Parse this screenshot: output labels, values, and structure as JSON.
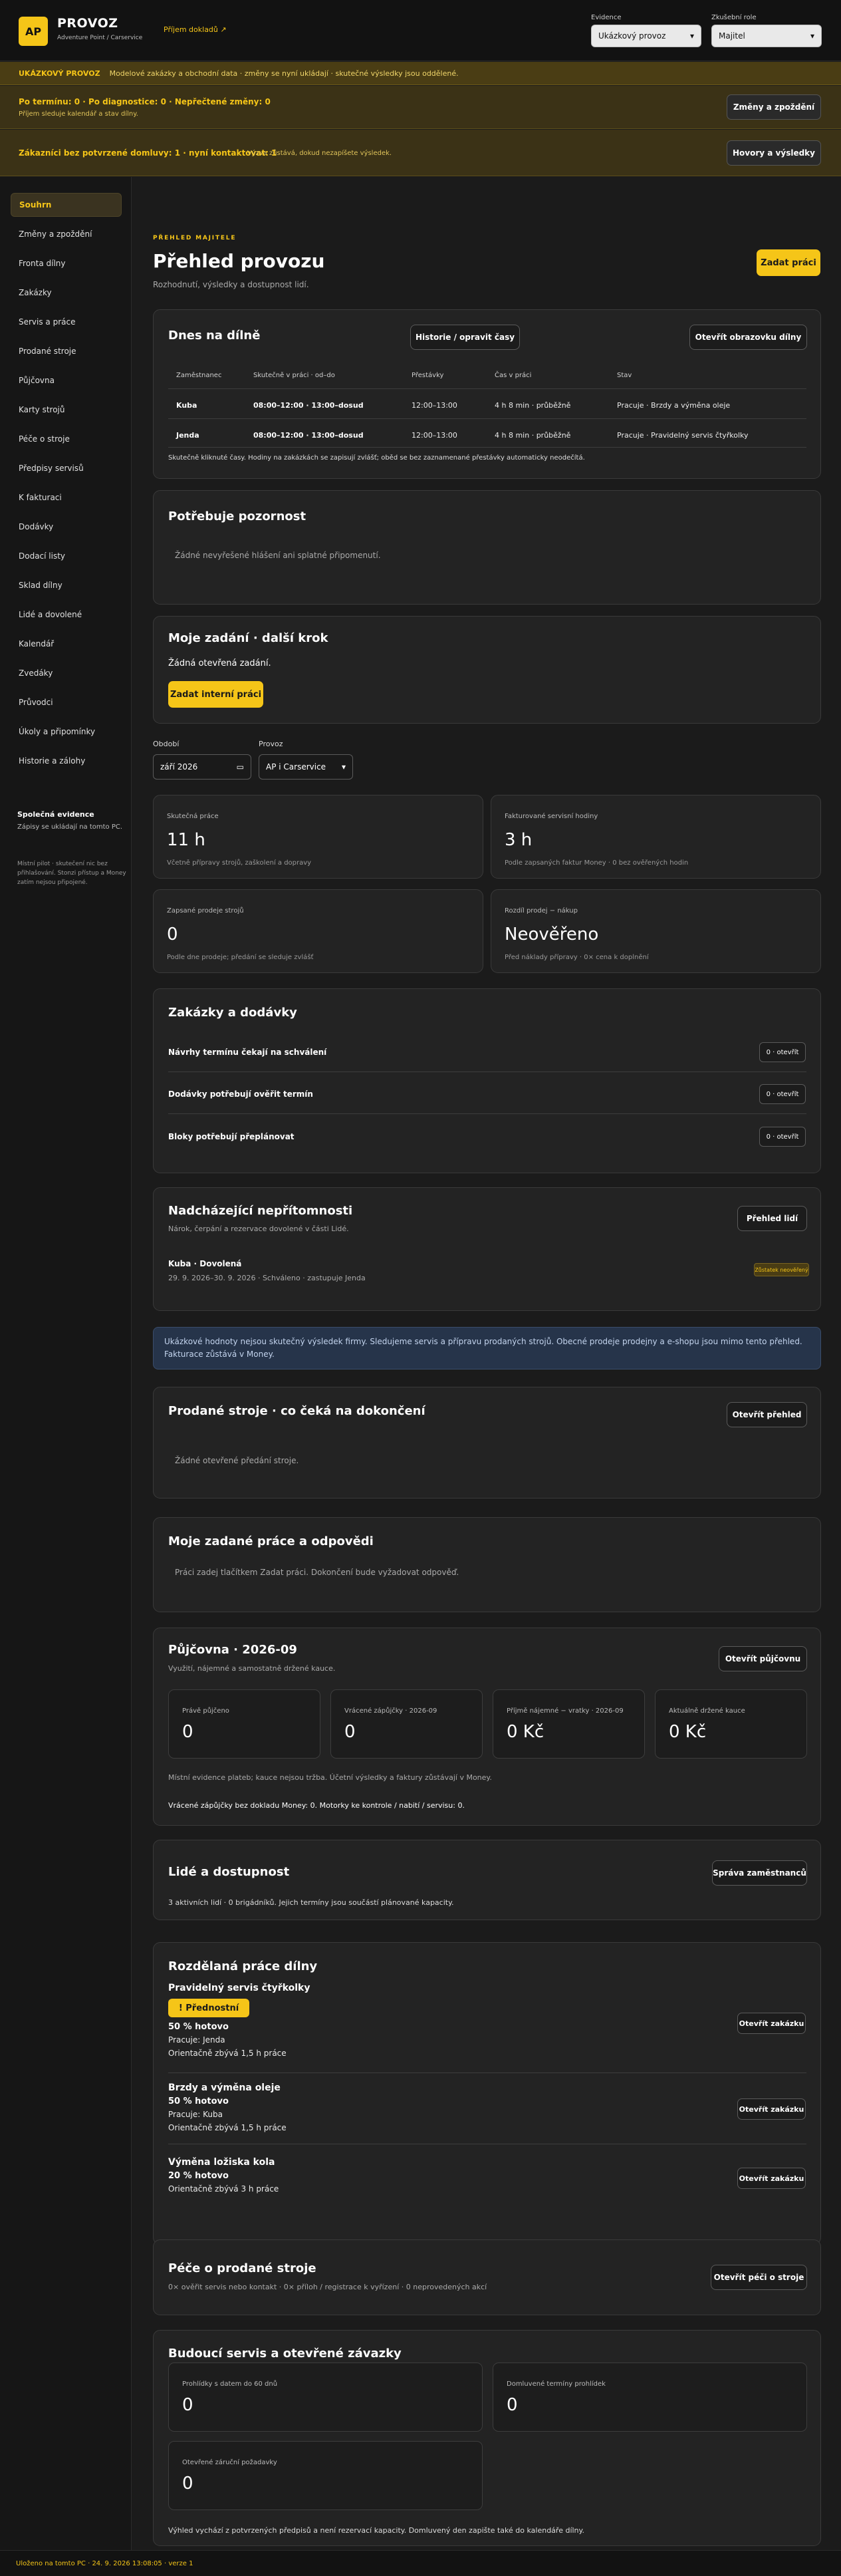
{
  "header": {
    "logo": "AP",
    "title": "PROVOZ",
    "subtitle": "Adventure Point / Carservice",
    "receive_link": "Příjem dokladů ↗",
    "evidence_label": "Evidence",
    "evidence_value": "Ukázkový provoz",
    "role_label": "Zkušební role",
    "role_value": "Majitel"
  },
  "banners": {
    "demo_badge": "UKÁZKOVÝ PROVOZ",
    "demo_text": "Modelové zakázky a obchodní data · změny se nyní ukládají · skutečné výsledky jsou oddělené.",
    "deadlines_title": "Po termínu: 0 · Po diagnostice: 0 · Nepřečtené změny: 0",
    "deadlines_sub": "Příjem sleduje kalendář a stav dílny.",
    "deadlines_button": "Změny a zpoždění",
    "unconfirmed_title": "Zákazníci bez potvrzené domluvy: 1 · nyní kontaktovat: 1",
    "unconfirmed_sub": "Výzva zůstává, dokud nezapíšete výsledek.",
    "unconfirmed_button": "Hovory a výsledky"
  },
  "sidebar": {
    "items": [
      "Souhrn",
      "Změny a zpoždění",
      "Fronta dílny",
      "Zakázky",
      "Servis a práce",
      "Prodané stroje",
      "Půjčovna",
      "Karty strojů",
      "Péče o stroje",
      "Předpisy servisů",
      "K fakturaci",
      "Dodávky",
      "Dodací listy",
      "Sklad dílny",
      "Lidé a dovolené",
      "Kalendář",
      "Zvedáky",
      "Průvodci",
      "Úkoly a připomínky",
      "Historie a zálohy"
    ],
    "note_title": "Společná evidence",
    "note_text": "Zápisy se ukládají na tomto PC.",
    "note_small": "Místní pilot · skutečení nic bez přihlašování. Stonzi přístup a Money zatím nejsou připojené."
  },
  "main": {
    "eyebrow": "PŘEHLED MAJITELE",
    "title": "Přehled provozu",
    "subtitle": "Rozhodnutí, výsledky a dostupnost lidí.",
    "add_work_button": "Zadat práci"
  },
  "today": {
    "title": "Dnes na dílně",
    "history_button": "Historie / opravit časy",
    "open_screen_button": "Otevřít obrazovku dílny",
    "columns": [
      "Zaměstnanec",
      "Skutečně v práci · od–do",
      "Přestávky",
      "Čas v práci",
      "Stav"
    ],
    "rows": [
      {
        "name": "Kuba",
        "time": "08:00–12:00 · 13:00–dosud",
        "pause": "12:00–13:00",
        "worked": "4 h 8 min · průběžně",
        "status": "Pracuje · Brzdy a výměna oleje"
      },
      {
        "name": "Jenda",
        "time": "08:00–12:00 · 13:00–dosud",
        "pause": "12:00–13:00",
        "worked": "4 h 8 min · průběžně",
        "status": "Pracuje · Pravidelný servis čtyřkolky"
      }
    ],
    "note": "Skutečně kliknuté časy. Hodiny na zakázkách se zapisují zvlášť; oběd se bez zaznamenané přestávky automaticky neodečítá."
  },
  "attention": {
    "title": "Potřebuje pozornost",
    "empty": "Žádné nevyřešené hlášení ani splatné připomenutí."
  },
  "my_tasks": {
    "title": "Moje zadání · další krok",
    "empty": "Žádná otevřená zadání.",
    "button": "Zadat interní práci"
  },
  "filters": {
    "period_label": "Období",
    "period_value": "září 2026",
    "operation_label": "Provoz",
    "operation_value": "AP i Carservice"
  },
  "stats": [
    {
      "label": "Skutečná práce",
      "value": "11 h",
      "note": "Včetně přípravy strojů, zaškolení a dopravy"
    },
    {
      "label": "Fakturované servisní hodiny",
      "value": "3 h",
      "note": "Podle zapsaných faktur Money · 0 bez ověřených hodin"
    },
    {
      "label": "Zapsané prodeje strojů",
      "value": "0",
      "note": "Podle dne prodeje; předání se sleduje zvlášť"
    },
    {
      "label": "Rozdíl prodej − nákup",
      "value": "Neověřeno",
      "note": "Před náklady přípravy · 0× cena k doplnění"
    }
  ],
  "orders": {
    "title": "Zakázky a dodávky",
    "rows": [
      {
        "label": "Návrhy termínu čekají na schválení",
        "count": "0 · otevřít"
      },
      {
        "label": "Dodávky potřebují ověřit termín",
        "count": "0 · otevřít"
      },
      {
        "label": "Bloky potřebují přeplánovat",
        "count": "0 · otevřít"
      }
    ]
  },
  "absences": {
    "title": "Nadcházející nepřítomnosti",
    "subtitle": "Nárok, čerpání a rezervace dovolené v části Lidé.",
    "button": "Přehled lidí",
    "item_title": "Kuba · Dovolená",
    "item_sub": "29. 9. 2026–30. 9. 2026 · Schváleno · zastupuje Jenda",
    "item_badge": "Zůstatek neověřený"
  },
  "info_box": "Ukázkové hodnoty nejsou skutečný výsledek firmy. Sledujeme servis a přípravu prodaných strojů. Obecné prodeje prodejny a e-shopu jsou mimo tento přehled. Fakturace zůstává v Money.",
  "sold_machines": {
    "title": "Prodané stroje · co čeká na dokončení",
    "button": "Otevřít přehled",
    "empty": "Žádné otevřené předání stroje."
  },
  "my_assigned": {
    "title": "Moje zadané práce a odpovědi",
    "empty": "Práci zadej tlačítkem Zadat práci. Dokončení bude vyžadovat odpověď."
  },
  "rental": {
    "title": "Půjčovna · 2026-09",
    "subtitle": "Využití, nájemné a samostatně držené kauce.",
    "button": "Otevřít půjčovnu",
    "tiles": [
      {
        "label": "Právě půjčeno",
        "value": "0"
      },
      {
        "label": "Vrácené zápůjčky · 2026-09",
        "value": "0"
      },
      {
        "label": "Příjmě nájemné − vratky · 2026-09",
        "value": "0 Kč"
      },
      {
        "label": "Aktuálně držené kauce",
        "value": "0 Kč"
      }
    ],
    "note1": "Místní evidence plateb; kauce nejsou tržba. Účetní výsledky a faktury zůstávají v Money.",
    "note2": "Vrácené zápůjčky bez dokladu Money: 0. Motorky ke kontrole / nabití / servisu: 0."
  },
  "people": {
    "title": "Lidé a dostupnost",
    "button": "Správa zaměstnanců",
    "text": "3 aktivních lidí · 0 brigádníků. Jejich termíny jsou součástí plánované kapacity."
  },
  "wip": {
    "title": "Rozdělaná práce dílny",
    "open_button": "Otevřít zakázku",
    "items": [
      {
        "name": "Pravidelný servis čtyřkolky",
        "priority": "! Přednostní",
        "progress": "50 % hotovo",
        "worker": "Pracuje: Jenda",
        "remaining": "Orientačně zbývá 1,5 h práce"
      },
      {
        "name": "Brzdy a výměna oleje",
        "progress": "50 % hotovo",
        "worker": "Pracuje: Kuba",
        "remaining": "Orientačně zbývá 1,5 h práce"
      },
      {
        "name": "Výměna ložiska kola",
        "progress": "20 % hotovo",
        "remaining": "Orientačně zbývá 3 h práce"
      }
    ]
  },
  "care": {
    "title": "Péče o prodané stroje",
    "subtitle": "0× ověřit servis nebo kontakt · 0× příloh / registrace k vyřízení · 0 neprovedených akcí",
    "button": "Otevřít péči o stroje"
  },
  "future": {
    "title": "Budoucí servis a otevřené závazky",
    "tiles": [
      {
        "label": "Prohlídky s datem do 60 dnů",
        "value": "0"
      },
      {
        "label": "Domluvené termíny prohlídek",
        "value": "0"
      },
      {
        "label": "Otevřené záruční požadavky",
        "value": "0"
      }
    ],
    "note": "Výhled vychází z potvrzených předpisů a není rezervací kapacity. Domluvený den zapište také do kalendáře dílny."
  },
  "footer": "Uloženo na tomto PC · 24. 9. 2026 13:08:05 · verze 1"
}
